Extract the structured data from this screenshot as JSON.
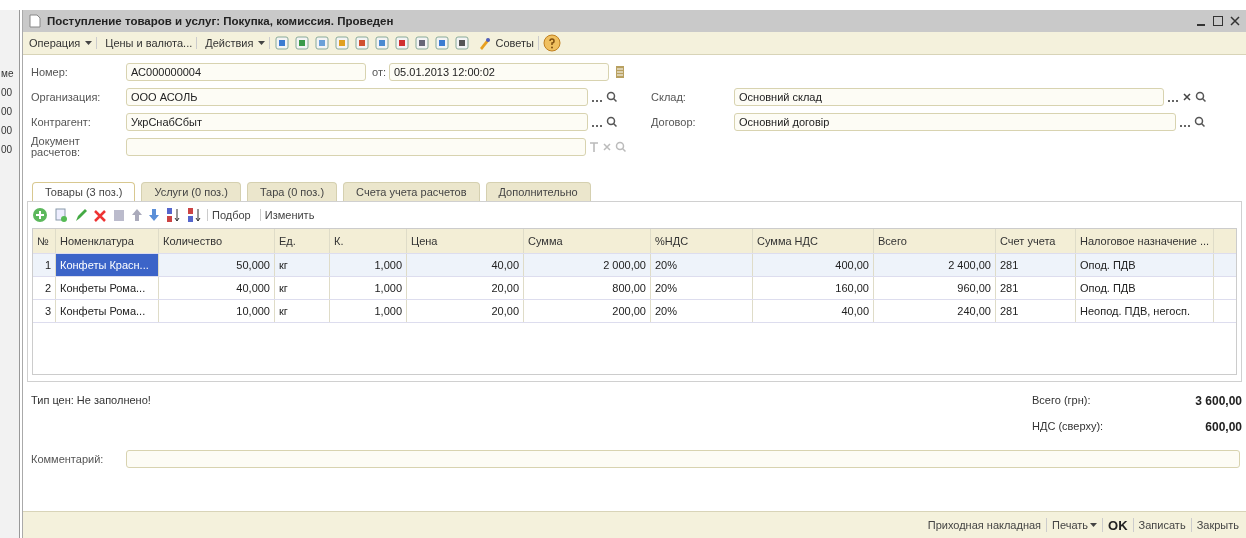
{
  "behind": [
    "ме",
    "00",
    "00",
    "00",
    "00"
  ],
  "window": {
    "title": "Поступление товаров и услуг: Покупка, комиссия. Проведен"
  },
  "toolbar": [
    {
      "label": "Операция",
      "dropdown": true
    },
    {
      "label": "Цены и валюта...",
      "dropdown": false
    },
    {
      "label": "Действия",
      "dropdown": true
    }
  ],
  "tips_button": "Советы",
  "header": {
    "number_label": "Номер:",
    "number": "АС000000004",
    "date_label": "от:",
    "date": "05.01.2013 12:00:02",
    "org_label": "Организация:",
    "org": "ООО АСОЛЬ",
    "warehouse_label": "Склад:",
    "warehouse": "Основний склад",
    "counterparty_label": "Контрагент:",
    "counterparty": "УкрСнабСбыт",
    "contract_label": "Договор:",
    "contract": "Основний договір",
    "doc_label": "Документ расчетов:"
  },
  "tabs": [
    {
      "label": "Товары (3 поз.)",
      "selected": true
    },
    {
      "label": "Услуги (0 поз.)",
      "selected": false
    },
    {
      "label": "Тара (0 поз.)",
      "selected": false
    },
    {
      "label": "Счета учета расчетов",
      "selected": false
    },
    {
      "label": "Дополнительно",
      "selected": false
    }
  ],
  "table_toolbar": [
    "Подбор",
    "Изменить"
  ],
  "table": {
    "columns": [
      "№",
      "Номенклатура",
      "Количество",
      "Ед.",
      "К.",
      "Цена",
      "Сумма",
      "%НДС",
      "Сумма НДС",
      "Всего",
      "Счет учета",
      "Налоговое назначение ..."
    ],
    "rows": [
      {
        "selected": true,
        "cells": [
          "1",
          "Конфеты Красн...",
          "50,000",
          "кг",
          "1,000",
          "40,00",
          "2 000,00",
          "20%",
          "400,00",
          "2 400,00",
          "281",
          "Опод. ПДВ"
        ]
      },
      {
        "selected": false,
        "cells": [
          "2",
          "Конфеты Рома...",
          "40,000",
          "кг",
          "1,000",
          "20,00",
          "800,00",
          "20%",
          "160,00",
          "960,00",
          "281",
          "Опод. ПДВ"
        ]
      },
      {
        "selected": false,
        "cells": [
          "3",
          "Конфеты Рома...",
          "10,000",
          "кг",
          "1,000",
          "20,00",
          "200,00",
          "20%",
          "40,00",
          "240,00",
          "281",
          "Неопод. ПДВ, негосп."
        ]
      }
    ]
  },
  "price_type": "Тип цен: Не заполнено!",
  "totals": [
    {
      "label": "Всего (грн):",
      "value": "3 600,00"
    },
    {
      "label": "НДС (сверху):",
      "value": "600,00"
    }
  ],
  "comment_label": "Комментарий:",
  "footer": [
    {
      "label": "Приходная накладная",
      "kind": "link"
    },
    {
      "label": "Печать",
      "kind": "menu"
    },
    {
      "label": "OK",
      "kind": "default"
    },
    {
      "label": "Записать",
      "kind": "link"
    },
    {
      "label": "Закрыть",
      "kind": "link"
    }
  ]
}
